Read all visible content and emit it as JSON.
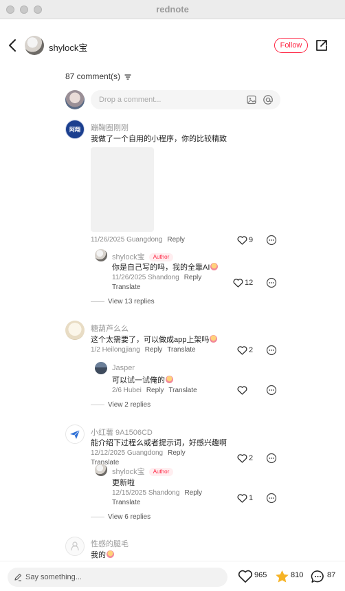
{
  "window": {
    "title": "rednote"
  },
  "header": {
    "author_name": "shylock宝",
    "follow_label": "Follow"
  },
  "comments_header": {
    "count_label": "87 comment(s)"
  },
  "comment_box": {
    "placeholder": "Drop a comment..."
  },
  "comments": [
    {
      "user": "蹦鞠圈刚刚",
      "text": "我做了一个自用的小程序，你的比较精致",
      "date_loc": "11/26/2025 Guangdong",
      "reply_label": "Reply",
      "likes": "9",
      "avatar_text": "阿翔",
      "replies": [
        {
          "user": "shylock宝",
          "badge": "Author",
          "text": "你是自己写的吗，我的全靠AI",
          "date_loc": "11/26/2025 Shandong",
          "reply_label": "Reply",
          "translate_label": "Translate",
          "likes": "12"
        }
      ],
      "view_replies": "View 13 replies"
    },
    {
      "user": "糖葫芦么么",
      "text": "这个太需要了，可以做成app上架吗",
      "date_loc": "1/2 Heilongjiang",
      "reply_label": "Reply",
      "translate_label": "Translate",
      "likes": "2",
      "replies": [
        {
          "user": "Jasper",
          "text": "可以试一试俺的",
          "date_loc": "2/6 Hubei",
          "reply_label": "Reply",
          "translate_label": "Translate",
          "likes": ""
        }
      ],
      "view_replies": "View 2 replies"
    },
    {
      "user": "小红薯 9A1506CD",
      "text": "能介绍下过程么或者提示词，好感兴趣啊",
      "date_loc": "12/12/2025 Guangdong",
      "reply_label": "Reply",
      "translate_label": "Translate",
      "likes": "2",
      "replies": [
        {
          "user": "shylock宝",
          "badge": "Author",
          "text": "更新啦",
          "date_loc": "12/15/2025 Shandong",
          "reply_label": "Reply",
          "translate_label": "Translate",
          "likes": "1"
        }
      ],
      "view_replies": "View 6 replies"
    },
    {
      "user": "性感的腿毛",
      "text": "我的"
    }
  ],
  "bottom_bar": {
    "placeholder": "Say something...",
    "likes": "965",
    "collects": "810",
    "comments": "87"
  },
  "colors": {
    "accent": "#ff2442",
    "star": "#f6b325"
  }
}
